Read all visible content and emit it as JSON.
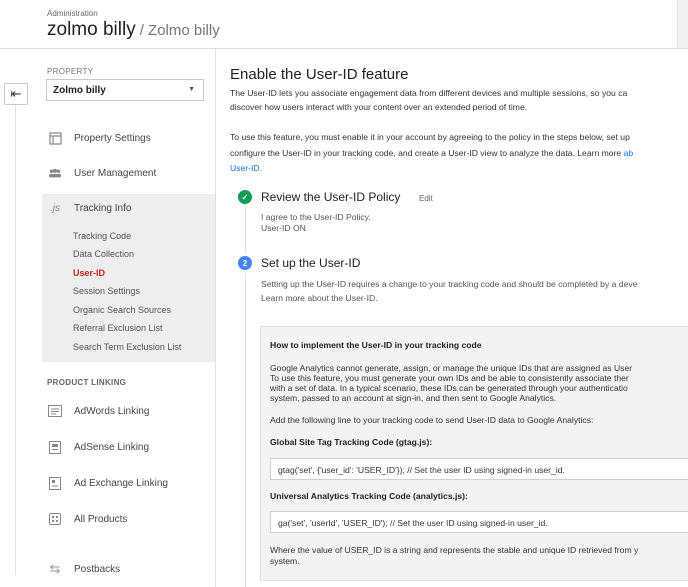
{
  "header": {
    "admin_label": "Administration",
    "account_name": "zolmo billy",
    "property_name": "/ Zolmo billy"
  },
  "sidebar": {
    "property_label": "PROPERTY",
    "property_value": "Zolmo billy",
    "items": [
      {
        "label": "Property Settings",
        "icon": "property-settings-icon"
      },
      {
        "label": "User Management",
        "icon": "users-icon"
      },
      {
        "label": "Tracking Info",
        "icon": "js-icon"
      }
    ],
    "tracking_sub": [
      {
        "label": "Tracking Code"
      },
      {
        "label": "Data Collection"
      },
      {
        "label": "User-ID"
      },
      {
        "label": "Session Settings"
      },
      {
        "label": "Organic Search Sources"
      },
      {
        "label": "Referral Exclusion List"
      },
      {
        "label": "Search Term Exclusion List"
      }
    ],
    "product_linking_label": "PRODUCT LINKING",
    "linking": [
      {
        "label": "AdWords Linking",
        "icon": "adwords-icon"
      },
      {
        "label": "AdSense Linking",
        "icon": "adsense-icon"
      },
      {
        "label": "Ad Exchange Linking",
        "icon": "adexchange-icon"
      },
      {
        "label": "All Products",
        "icon": "all-products-icon"
      }
    ],
    "postbacks": {
      "label": "Postbacks",
      "icon": "postbacks-icon"
    }
  },
  "main": {
    "title": "Enable the User-ID feature",
    "intro_line1": "The User-ID lets you associate engagement data from different devices and multiple sessions, so you ca",
    "intro_line2": "discover how users interact with your content over an extended period of time.",
    "use_line1": "To use this feature, you must enable it in your account by agreeing to the policy in the steps below, set up",
    "use_line2_pre": "configure the User-ID in your tracking code, and create a User-ID view to analyze the data. Learn more ",
    "use_line2_link": "ab",
    "use_line3_link": "User-ID.",
    "step1": {
      "title": "Review the User-ID Policy",
      "edit": "Edit",
      "line1": "I agree to the User-ID Policy.",
      "line2": "User-ID ON"
    },
    "step2": {
      "number": "2",
      "title": "Set up the User-ID",
      "line1": "Setting up the User-ID requires a change to your tracking code and should be completed by a deve",
      "line2": "Learn more about the User-ID."
    },
    "howto": {
      "title": "How to implement the User-ID in your tracking code",
      "p1_l1": "Google Analytics cannot generate, assign, or manage the unique IDs that are assigned as User",
      "p1_l2": "To use this feature, you must generate your own IDs and be able to consistently associate ther",
      "p1_l3": "with a set of data. In a typical scenario, these IDs can be generated through your authenticatio",
      "p1_l4": "system, passed to an account at sign-in, and then sent to Google Analytics.",
      "add_line": "Add the following line to your tracking code to send User-ID data to Google Analytics:",
      "gtag_label": "Global Site Tag Tracking Code (gtag.js):",
      "gtag_code": "gtag('set', {'user_id': 'USER_ID'}); // Set the user ID using signed-in user_id.",
      "ua_label": "Universal Analytics Tracking Code (analytics.js):",
      "ua_code": "ga('set', 'userId', 'USER_ID'); // Set the user ID using signed-in user_id.",
      "where_l1": "Where the value of USER_ID is a string and represents the stable and unique ID retrieved from y",
      "where_l2": "system."
    }
  }
}
